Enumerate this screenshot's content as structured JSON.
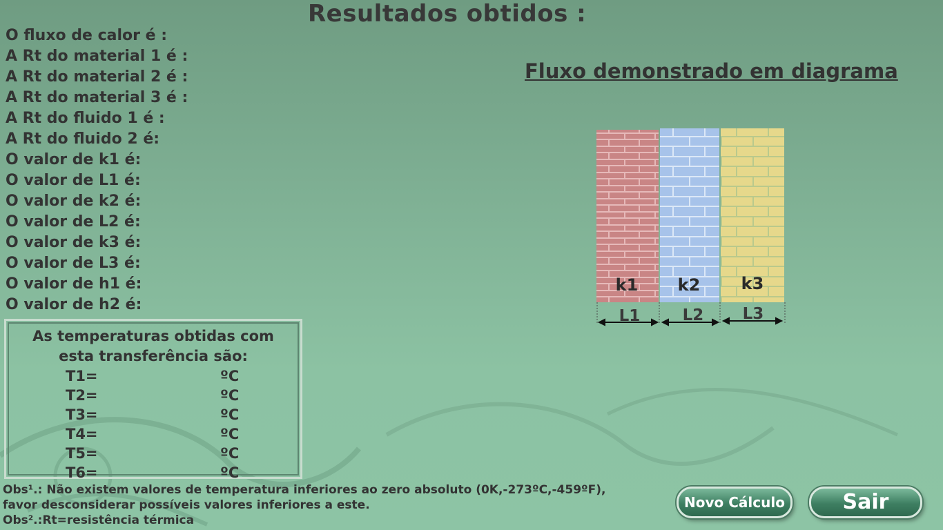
{
  "title": "Resultados obtidos :",
  "results": [
    "O fluxo de calor é :",
    "A Rt do material 1 é :",
    "A Rt do material 2 é :",
    "A Rt do material 3 é :",
    "A Rt do fluido 1 é :",
    "A Rt do fluido 2 é:",
    "O valor de k1 é:",
    "O valor de L1 é:",
    "O valor de k2 é:",
    "O valor de L2 é:",
    "O valor de k3 é:",
    "O valor de L3 é:",
    "O valor de h1 é:",
    "O valor de h2 é:"
  ],
  "diagram": {
    "heading": "Fluxo demonstrado em diagrama",
    "layers": [
      {
        "k": "k1",
        "L": "L1",
        "color": "#c98585",
        "mortar": "#e6b9b9"
      },
      {
        "k": "k2",
        "L": "L2",
        "color": "#a7c3ea",
        "mortar": "#dce8f7"
      },
      {
        "k": "k3",
        "L": "L3",
        "color": "#e6d88b",
        "mortar": "#b9c98c"
      }
    ]
  },
  "temperatures": {
    "heading_line1": "As temperaturas obtidas com",
    "heading_line2": "esta transferência são:",
    "unit": "ºC",
    "rows": [
      "T1=",
      "T2=",
      "T3=",
      "T4=",
      "T5=",
      "T6="
    ]
  },
  "obs": {
    "line1": "Obs¹.: Não existem valores de temperatura inferiores ao zero absoluto (0K,-273ºC,-459ºF),",
    "line2": "favor desconsiderar possíveis valores inferiores a este.",
    "line3": "Obs².:Rt=resistência térmica"
  },
  "buttons": {
    "novo": "Novo Cálculo",
    "sair": "Sair"
  },
  "colors": {
    "button_green": "#3e7f62",
    "background": "#7eaf93"
  }
}
